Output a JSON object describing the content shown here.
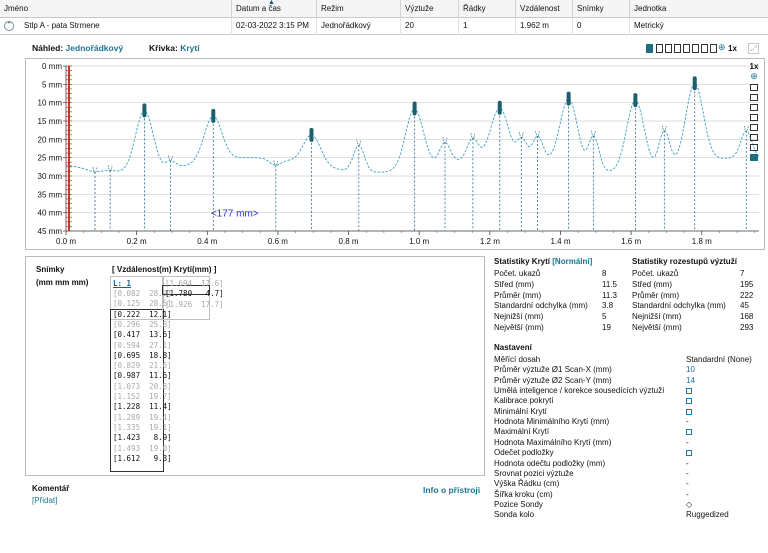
{
  "table": {
    "columns": [
      "Jméno",
      "Datum a čas",
      "Režim",
      "Výztuže",
      "Řádky",
      "Vzdálenost",
      "Snímky",
      "Jednotka"
    ],
    "row": [
      "Stlp A - pata Strmene",
      "02-03-2022 3:15 PM",
      "Jednořádkový",
      "20",
      "1",
      "1.962 m",
      "0",
      "Metrický"
    ]
  },
  "preview": {
    "nahled_label": "Náhled:",
    "nahled_value": "Jednořádkový",
    "krivka_label": "Křivka:",
    "krivka_value": "Krytí",
    "zoom_label": "1x",
    "side_zoom_label": "1x"
  },
  "chart_data": {
    "type": "line",
    "xlabel": "",
    "ylabel": "",
    "x_ticks": [
      "0.0 m",
      "0.2 m",
      "0.4 m",
      "0.6 m",
      "0.8 m",
      "1.0 m",
      "1.2 m",
      "1.4 m",
      "1.6 m",
      "1.8 m"
    ],
    "y_ticks": [
      "0 mm",
      "5 mm",
      "10 mm",
      "15 mm",
      "20 mm",
      "25 mm",
      "30 mm",
      "35 mm",
      "40 mm",
      "45 mm"
    ],
    "xlim": [
      0,
      1.962
    ],
    "ylim": [
      0,
      45
    ],
    "annotation": "<177 mm>",
    "rebars": [
      {
        "x": 0.082,
        "cover": 28.9,
        "selected": false
      },
      {
        "x": 0.125,
        "cover": 28.5,
        "selected": false
      },
      {
        "x": 0.222,
        "cover": 12.1,
        "selected": true
      },
      {
        "x": 0.296,
        "cover": 25.8,
        "selected": false
      },
      {
        "x": 0.417,
        "cover": 13.6,
        "selected": true
      },
      {
        "x": 0.594,
        "cover": 27.1,
        "selected": false
      },
      {
        "x": 0.695,
        "cover": 18.8,
        "selected": true
      },
      {
        "x": 0.829,
        "cover": 21.6,
        "selected": false
      },
      {
        "x": 0.987,
        "cover": 11.6,
        "selected": true
      },
      {
        "x": 1.073,
        "cover": 20.8,
        "selected": false
      },
      {
        "x": 1.152,
        "cover": 19.7,
        "selected": false
      },
      {
        "x": 1.228,
        "cover": 11.4,
        "selected": true
      },
      {
        "x": 1.289,
        "cover": 19.4,
        "selected": false
      },
      {
        "x": 1.335,
        "cover": 19.1,
        "selected": false
      },
      {
        "x": 1.423,
        "cover": 8.9,
        "selected": true
      },
      {
        "x": 1.493,
        "cover": 19.0,
        "selected": false
      },
      {
        "x": 1.612,
        "cover": 9.3,
        "selected": true
      },
      {
        "x": 1.694,
        "cover": 17.6,
        "selected": false
      },
      {
        "x": 1.78,
        "cover": 4.7,
        "selected": true
      },
      {
        "x": 1.926,
        "cover": 17.7,
        "selected": false
      }
    ]
  },
  "snimky": {
    "title": "Snímky",
    "units": "(mm  mm  mm)",
    "columns": "[ Vzdálenost(m)  Krytí(mm) ]",
    "selected_label": "L: 1",
    "rows": [
      {
        "text": "[0.082  28.9]",
        "grey": true
      },
      {
        "text": "[0.125  28.5]",
        "grey": true
      },
      {
        "text": "[0.222  12.1]",
        "grey": false
      },
      {
        "text": "[0.296  25.8]",
        "grey": true
      },
      {
        "text": "[0.417  13.6]",
        "grey": false
      },
      {
        "text": "[0.594  27.1]",
        "grey": true
      },
      {
        "text": "[0.695  18.8]",
        "grey": false
      },
      {
        "text": "[0.829  21.6]",
        "grey": true
      },
      {
        "text": "[0.987  11.6]",
        "grey": false
      },
      {
        "text": "[1.073  20.8]",
        "grey": true
      },
      {
        "text": "[1.152  19.7]",
        "grey": true
      },
      {
        "text": "[1.228  11.4]",
        "grey": false
      },
      {
        "text": "[1.289  19.4]",
        "grey": true
      },
      {
        "text": "[1.335  19.1]",
        "grey": true
      },
      {
        "text": "[1.423   8.9]",
        "grey": false
      },
      {
        "text": "[1.493  19.0]",
        "grey": true
      },
      {
        "text": "[1.612   9.3]",
        "grey": false
      }
    ],
    "col2": [
      {
        "text": "[1.694  17.6]",
        "grey": true
      },
      {
        "text": "[1.780   4.7]",
        "grey": false
      },
      {
        "text": "[1.926  17.7]",
        "grey": true
      }
    ]
  },
  "comment": {
    "label": "Komentář",
    "add": "[Přidat]"
  },
  "info_label": "Info o přístroji",
  "stats_cover": {
    "title": "Statistiky Krytí",
    "mode": "[Normální]",
    "rows": [
      {
        "k": "Počet. ukazů",
        "v": "8"
      },
      {
        "k": "Střed (mm)",
        "v": "11.5"
      },
      {
        "k": "Průměr (mm)",
        "v": "11.3"
      },
      {
        "k": "Standardní odchylka (mm)",
        "v": "3.8"
      },
      {
        "k": "Nejnižší (mm)",
        "v": "5"
      },
      {
        "k": "Největší (mm)",
        "v": "19"
      }
    ]
  },
  "stats_spacing": {
    "title": "Statistiky rozestupů výztuží",
    "rows": [
      {
        "k": "Počet. ukazů",
        "v": "7"
      },
      {
        "k": "Střed (mm)",
        "v": "195"
      },
      {
        "k": "Průměr (mm)",
        "v": "222"
      },
      {
        "k": "Standardní odchylka (mm)",
        "v": "45"
      },
      {
        "k": "Nejnižší (mm)",
        "v": "168"
      },
      {
        "k": "Největší (mm)",
        "v": "293"
      }
    ]
  },
  "settings": {
    "title": "Nastavení",
    "rows": [
      {
        "k": "Měřící dosah",
        "v": "Standardní (None)",
        "t": "text"
      },
      {
        "k": "Průměr výztuže Ø1 Scan-X (mm)",
        "v": "10",
        "t": "link"
      },
      {
        "k": "Průměr výztuže Ø2 Scan-Y (mm)",
        "v": "14",
        "t": "link"
      },
      {
        "k": "Umělá inteligence / korekce sousedících výztuží",
        "v": "",
        "t": "check"
      },
      {
        "k": "Kalibrace pokrytí",
        "v": "",
        "t": "check"
      },
      {
        "k": "Minimální Krytí",
        "v": "",
        "t": "check"
      },
      {
        "k": "  Hodnota Minimálního Krytí (mm)",
        "v": "-",
        "t": "text"
      },
      {
        "k": "Maximální Krytí",
        "v": "",
        "t": "check"
      },
      {
        "k": "  Hodnota Maximálního Krytí (mm)",
        "v": "-",
        "t": "text"
      },
      {
        "k": "Odečet podložky",
        "v": "",
        "t": "check"
      },
      {
        "k": "  Hodnota  odečtu podložky (mm)",
        "v": "-",
        "t": "text"
      },
      {
        "k": "Srovnat pozici výztuže",
        "v": "-",
        "t": "text"
      },
      {
        "k": "Výška Řádku (cm)",
        "v": "-",
        "t": "text"
      },
      {
        "k": "Šířka kroku (cm)",
        "v": "-",
        "t": "text"
      },
      {
        "k": "Pozice Sondy",
        "v": "◇",
        "t": "text"
      },
      {
        "k": "Sonda kolo",
        "v": "Ruggedized",
        "t": "text"
      }
    ]
  },
  "colors": {
    "accent": "#1d7590",
    "rebar": "#1d5f6e",
    "curve": "#3aa0c8",
    "cursor": "#c0392b",
    "annotation": "#2b35c8"
  }
}
